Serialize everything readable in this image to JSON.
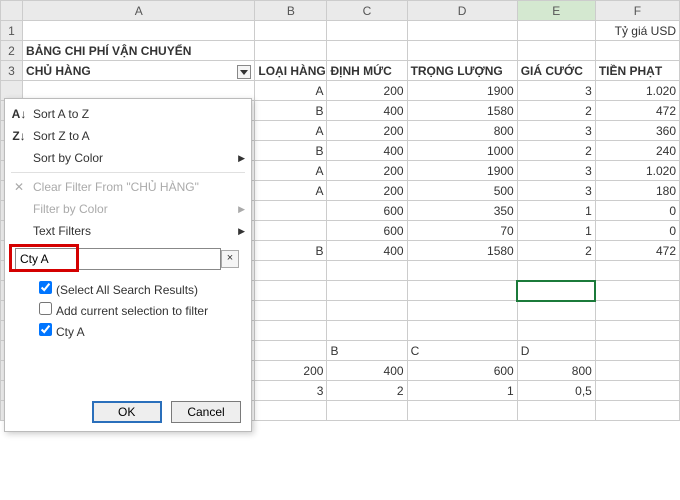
{
  "columns": [
    "A",
    "B",
    "C",
    "D",
    "E",
    "F"
  ],
  "sel_col": "E",
  "row1": {
    "F": "Tỷ giá USD"
  },
  "row2": {
    "A": "BẢNG CHI PHÍ VẬN CHUYỂN"
  },
  "row3": {
    "A": "CHỦ HÀNG",
    "B": "LOẠI HÀNG",
    "C": "ĐỊNH MỨC",
    "D": "TRỌNG LƯỢNG",
    "E": "GIÁ CƯỚC",
    "F": "TIỀN PHẠT"
  },
  "data_rows": [
    {
      "b": "A",
      "c": "200",
      "d": "1900",
      "e": "3",
      "f": "1.020"
    },
    {
      "b": "B",
      "c": "400",
      "d": "1580",
      "e": "2",
      "f": "472"
    },
    {
      "b": "A",
      "c": "200",
      "d": "800",
      "e": "3",
      "f": "360"
    },
    {
      "b": "B",
      "c": "400",
      "d": "1000",
      "e": "2",
      "f": "240"
    },
    {
      "b": "A",
      "c": "200",
      "d": "1900",
      "e": "3",
      "f": "1.020"
    },
    {
      "b": "A",
      "c": "200",
      "d": "500",
      "e": "3",
      "f": "180"
    },
    {
      "b": "",
      "c": "600",
      "d": "350",
      "e": "1",
      "f": "0"
    },
    {
      "b": "",
      "c": "600",
      "d": "70",
      "e": "1",
      "f": "0"
    },
    {
      "b": "B",
      "c": "400",
      "d": "1580",
      "e": "2",
      "f": "472"
    }
  ],
  "bottom_headers": [
    "B",
    "C",
    "D"
  ],
  "bottom_r1": [
    "200",
    "400",
    "600",
    "800"
  ],
  "bottom_r2": [
    "3",
    "2",
    "1",
    "0,5"
  ],
  "menu": {
    "sort_az": "Sort A to Z",
    "sort_za": "Sort Z to A",
    "sort_color": "Sort by Color",
    "clear": "Clear Filter From \"CHỦ HÀNG\"",
    "filter_color": "Filter by Color",
    "text_filters": "Text Filters",
    "search_value": "Cty A",
    "chk_all": "(Select All Search Results)",
    "chk_add": "Add current selection to filter",
    "chk_a": "Cty A",
    "ok": "OK",
    "cancel": "Cancel"
  },
  "chart_data": {
    "type": "table",
    "title": "BẢNG CHI PHÍ VẬN CHUYỂN",
    "columns": [
      "CHỦ HÀNG",
      "LOẠI HÀNG",
      "ĐỊNH MỨC",
      "TRỌNG LƯỢNG",
      "GIÁ CƯỚC",
      "TIỀN PHẠT"
    ],
    "rows": [
      [
        "",
        "A",
        200,
        1900,
        3,
        1020
      ],
      [
        "",
        "B",
        400,
        1580,
        2,
        472
      ],
      [
        "",
        "A",
        200,
        800,
        3,
        360
      ],
      [
        "",
        "B",
        400,
        1000,
        2,
        240
      ],
      [
        "",
        "A",
        200,
        1900,
        3,
        1020
      ],
      [
        "",
        "A",
        200,
        500,
        3,
        180
      ],
      [
        "",
        "",
        600,
        350,
        1,
        0
      ],
      [
        "",
        "",
        600,
        70,
        1,
        0
      ],
      [
        "",
        "B",
        400,
        1580,
        2,
        472
      ]
    ],
    "note": "Tỷ giá USD"
  }
}
